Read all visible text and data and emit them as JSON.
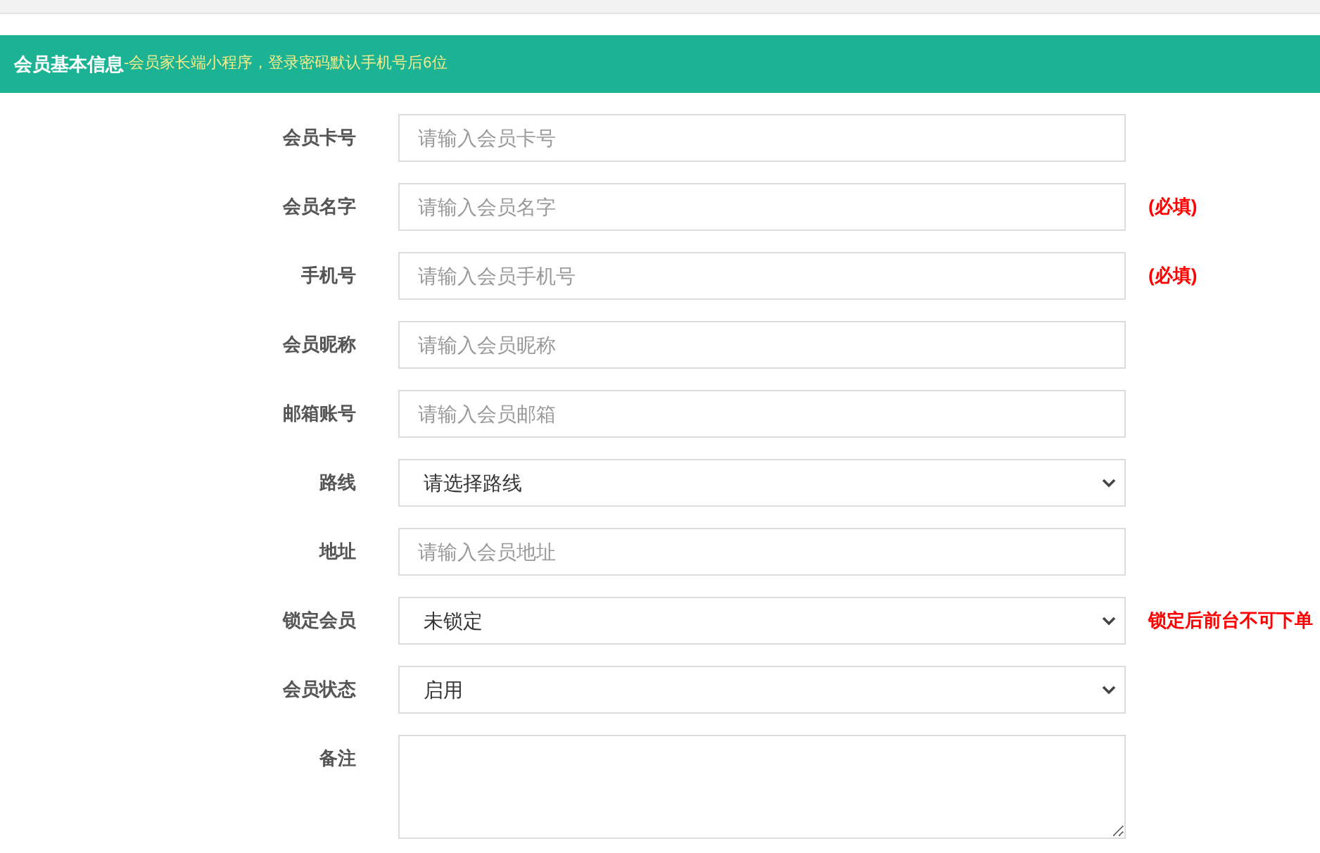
{
  "header": {
    "title": "会员基本信息",
    "subtitle": "-会员家长端小程序，登录密码默认手机号后6位"
  },
  "fields": [
    {
      "kind": "input",
      "label": "会员卡号",
      "placeholder": "请输入会员卡号"
    },
    {
      "kind": "input",
      "label": "会员名字",
      "placeholder": "请输入会员名字",
      "note": "(必填)"
    },
    {
      "kind": "input",
      "label": "手机号",
      "placeholder": "请输入会员手机号",
      "note": "(必填)"
    },
    {
      "kind": "input",
      "label": "会员昵称",
      "placeholder": "请输入会员昵称"
    },
    {
      "kind": "input",
      "label": "邮箱账号",
      "placeholder": "请输入会员邮箱"
    },
    {
      "kind": "select",
      "label": "路线",
      "value": "请选择路线"
    },
    {
      "kind": "input",
      "label": "地址",
      "placeholder": "请输入会员地址"
    },
    {
      "kind": "select",
      "label": "锁定会员",
      "value": "未锁定",
      "note": "锁定后前台不可下单"
    },
    {
      "kind": "select",
      "label": "会员状态",
      "value": "启用"
    },
    {
      "kind": "textarea",
      "label": "备注"
    }
  ]
}
